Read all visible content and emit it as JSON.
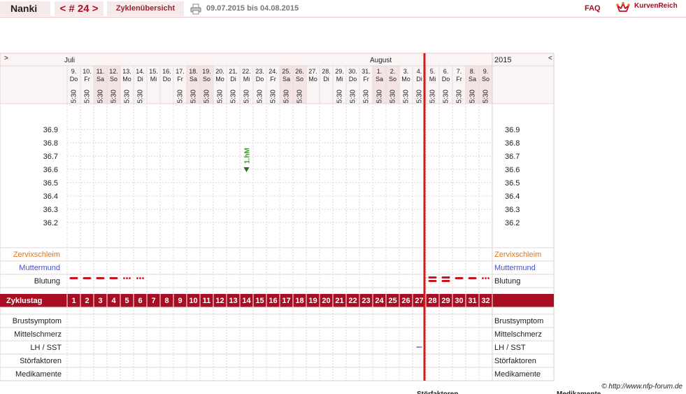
{
  "topbar": {
    "user": "Nanki",
    "cycle_nav": "< # 24 >",
    "overview": "Zyklenübersicht",
    "date_range": "09.07.2015 bis 04.08.2015",
    "faq": "FAQ",
    "logo": "KurvenReich"
  },
  "chart_data": {
    "type": "line",
    "nav_prev": ">",
    "nav_next": "<",
    "year": "2015",
    "months": [
      {
        "label": "Juli",
        "day_index": 0
      },
      {
        "label": "August",
        "day_index": 23
      }
    ],
    "days": [
      {
        "d": "9.",
        "w": "Do",
        "t": "5:30",
        "we": false
      },
      {
        "d": "10.",
        "w": "Fr",
        "t": "5:30",
        "we": false
      },
      {
        "d": "11.",
        "w": "Sa",
        "t": "5:30",
        "we": true
      },
      {
        "d": "12.",
        "w": "So",
        "t": "5:30",
        "we": true
      },
      {
        "d": "13.",
        "w": "Mo",
        "t": "5:30",
        "we": false
      },
      {
        "d": "14.",
        "w": "Di",
        "t": "5:30",
        "we": false
      },
      {
        "d": "15.",
        "w": "Mi",
        "t": "",
        "we": false
      },
      {
        "d": "16.",
        "w": "Do",
        "t": "",
        "we": false
      },
      {
        "d": "17.",
        "w": "Fr",
        "t": "5:30",
        "we": false
      },
      {
        "d": "18.",
        "w": "Sa",
        "t": "5:30",
        "we": true
      },
      {
        "d": "19.",
        "w": "So",
        "t": "5:30",
        "we": true
      },
      {
        "d": "20.",
        "w": "Mo",
        "t": "5:30",
        "we": false
      },
      {
        "d": "21.",
        "w": "Di",
        "t": "5:30",
        "we": false
      },
      {
        "d": "22.",
        "w": "Mi",
        "t": "5:30",
        "we": false
      },
      {
        "d": "23.",
        "w": "Do",
        "t": "5:30",
        "we": false
      },
      {
        "d": "24.",
        "w": "Fr",
        "t": "5:30",
        "we": false
      },
      {
        "d": "25.",
        "w": "Sa",
        "t": "5:30",
        "we": true
      },
      {
        "d": "26.",
        "w": "So",
        "t": "5:30",
        "we": true
      },
      {
        "d": "27.",
        "w": "Mo",
        "t": "",
        "we": false
      },
      {
        "d": "28.",
        "w": "Di",
        "t": "",
        "we": false
      },
      {
        "d": "29.",
        "w": "Mi",
        "t": "5:30",
        "we": false
      },
      {
        "d": "30.",
        "w": "Do",
        "t": "5:30",
        "we": false
      },
      {
        "d": "31.",
        "w": "Fr",
        "t": "5:30",
        "we": false
      },
      {
        "d": "1.",
        "w": "Sa",
        "t": "5:30",
        "we": true
      },
      {
        "d": "2.",
        "w": "So",
        "t": "5:30",
        "we": true
      },
      {
        "d": "3.",
        "w": "Mo",
        "t": "5:30",
        "we": false
      },
      {
        "d": "4.",
        "w": "Di",
        "t": "5:30",
        "we": false
      },
      {
        "d": "5.",
        "w": "Mi",
        "t": "5:30",
        "we": false
      },
      {
        "d": "6.",
        "w": "Do",
        "t": "5:30",
        "we": false
      },
      {
        "d": "7.",
        "w": "Fr",
        "t": "5:30",
        "we": false
      },
      {
        "d": "8.",
        "w": "Sa",
        "t": "5:30",
        "we": true
      },
      {
        "d": "9.",
        "w": "So",
        "t": "5:30",
        "we": true
      }
    ],
    "temp_ticks": [
      "36.9",
      "36.8",
      "36.7",
      "36.6",
      "36.5",
      "36.4",
      "36.3",
      "36.2"
    ],
    "temp_range": [
      36.1,
      37.0
    ],
    "points": [
      {
        "day_index": 13,
        "temp": 36.6,
        "label": "1.hM"
      }
    ],
    "cycle_end_after_day_index": 26,
    "rows_top": [
      "Zervixschleim",
      "Muttermund",
      "Blutung"
    ],
    "row_colors": {
      "Zervixschleim": "#e07818",
      "Muttermund": "#4450c8",
      "Blutung": "#222222"
    },
    "bleeding": [
      {
        "day_index": 0,
        "kind": "dash"
      },
      {
        "day_index": 1,
        "kind": "dash"
      },
      {
        "day_index": 2,
        "kind": "dash"
      },
      {
        "day_index": 3,
        "kind": "dash"
      },
      {
        "day_index": 4,
        "kind": "dots"
      },
      {
        "day_index": 5,
        "kind": "dots"
      },
      {
        "day_index": 27,
        "kind": "double"
      },
      {
        "day_index": 28,
        "kind": "double"
      },
      {
        "day_index": 29,
        "kind": "dash"
      },
      {
        "day_index": 30,
        "kind": "dash"
      },
      {
        "day_index": 31,
        "kind": "dots"
      }
    ],
    "cycle_label": "Zyklustag",
    "cycle_days": [
      "1",
      "2",
      "3",
      "4",
      "5",
      "6",
      "7",
      "8",
      "9",
      "10",
      "11",
      "12",
      "13",
      "14",
      "15",
      "16",
      "17",
      "18",
      "19",
      "20",
      "21",
      "22",
      "23",
      "24",
      "25",
      "26",
      "27",
      "28",
      "29",
      "30",
      "31",
      "32"
    ],
    "rows_bottom": [
      "Brustsymptom",
      "Mittelschmerz",
      "LH / SST",
      "Störfaktoren",
      "Medikamente"
    ],
    "lh_marks": [
      {
        "day_index": 26
      }
    ],
    "footer": "© http://www.nfp-forum.de",
    "cut_labels": [
      "Störfaktoren",
      "Medikamente"
    ],
    "colors": {
      "accent": "#a80e22",
      "weekend": "#f3e3e3",
      "grid": "#e3d3d3",
      "point": "#3f9a33",
      "lh": "#4450c8"
    }
  }
}
